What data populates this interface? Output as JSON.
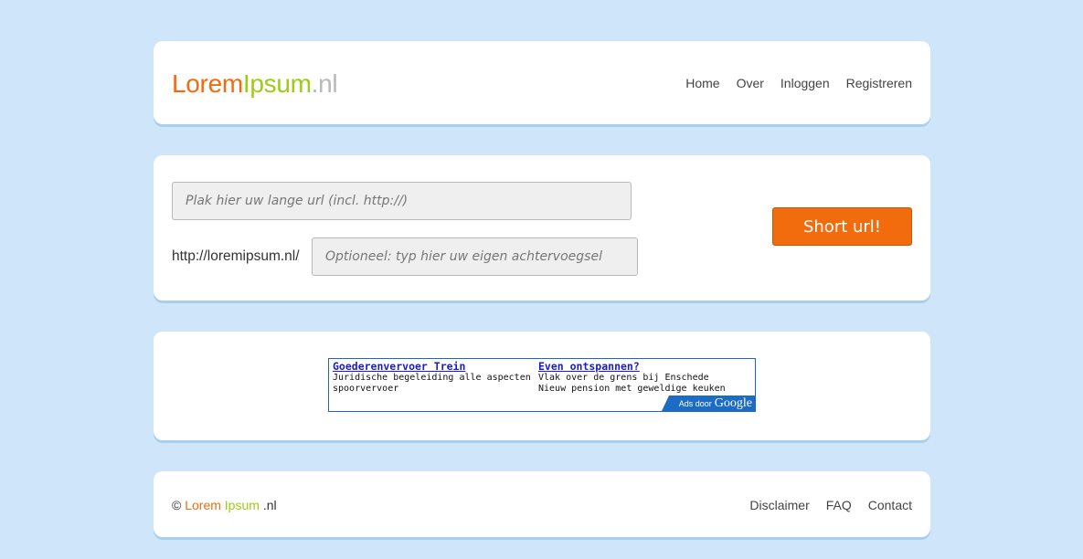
{
  "header": {
    "logo": {
      "part1": "Lorem",
      "part2": "Ipsum",
      "part3": ".nl",
      "colors": [
        "#f26b10",
        "#9ccc14",
        "#b8b8b8"
      ]
    },
    "nav": [
      "Home",
      "Over",
      "Inloggen",
      "Registreren"
    ]
  },
  "shortener": {
    "long_url_placeholder": "Plak hier uw lange url (incl. http://)",
    "prefix": "http://loremipsum.nl/",
    "suffix_placeholder": "Optioneel: typ hier uw eigen achtervoegsel",
    "button_label": "Short url!",
    "button_color": "#f26c0d"
  },
  "ads": {
    "items": [
      {
        "title": "Goederenvervoer Trein",
        "text": "Juridische begeleiding alle aspecten spoorvervoer"
      },
      {
        "title": "Even ontspannen?",
        "text": "Vlak over de grens bij Enschede Nieuw pension met geweldige keuken"
      }
    ],
    "ads_by_label": "Ads door",
    "ads_by_brand": "Google"
  },
  "footer": {
    "copyright_symbol": "©",
    "brand1": "Lorem",
    "brand2": "Ipsum",
    "brand3": ".nl",
    "links": [
      "Disclaimer",
      "FAQ",
      "Contact"
    ]
  },
  "colors": {
    "background": "#cfe6fa",
    "panel": "#ffffff",
    "accent": "#f26b10",
    "green": "#9ccc14"
  }
}
